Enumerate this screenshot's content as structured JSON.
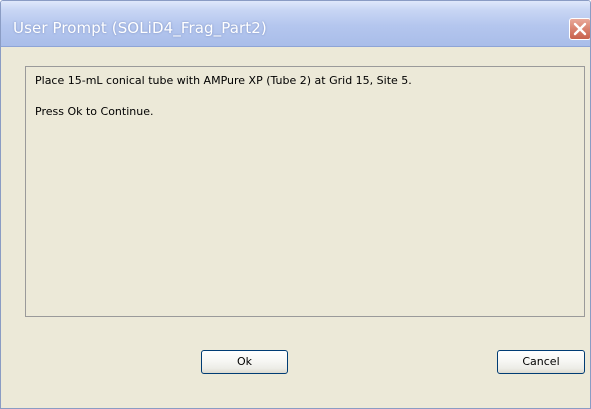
{
  "window": {
    "title": "User Prompt (SOLiD4_Frag_Part2)"
  },
  "message": {
    "line1": "Place 15-mL conical tube with AMPure XP (Tube 2) at Grid 15, Site 5.",
    "line2": "Press Ok to Continue."
  },
  "buttons": {
    "ok_label": "Ok",
    "cancel_label": "Cancel"
  },
  "icons": {
    "close": "close-icon"
  },
  "colors": {
    "titlebar": "#b4c6ee",
    "dialog_background": "#ece9d8",
    "close_button": "#d9826f",
    "button_border": "#003c74"
  }
}
